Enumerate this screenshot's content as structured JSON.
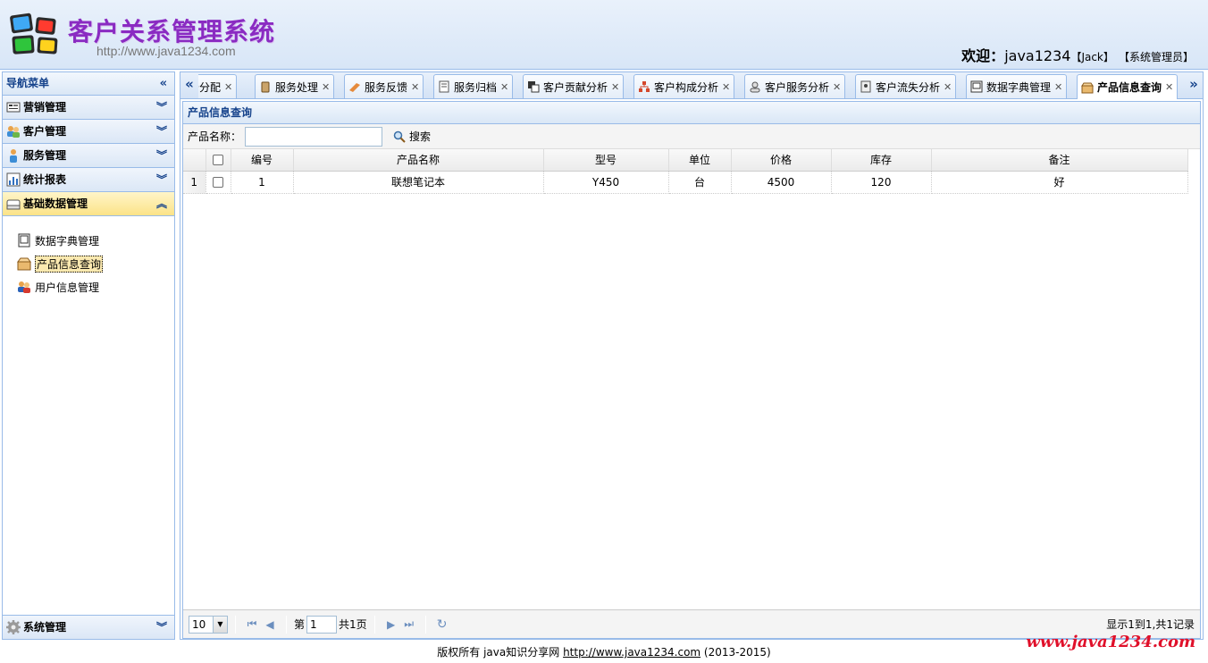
{
  "header": {
    "title": "客户关系管理系统",
    "url": "http://www.java1234.com",
    "welcome_prefix": "欢迎：",
    "username": "java1234",
    "true_name": "【Jack】",
    "role": "【系统管理员】"
  },
  "nav": {
    "title": "导航菜单",
    "sections": [
      {
        "label": "营销管理",
        "icon": "marketing-icon"
      },
      {
        "label": "客户管理",
        "icon": "customer-icon"
      },
      {
        "label": "服务管理",
        "icon": "service-icon"
      },
      {
        "label": "统计报表",
        "icon": "report-icon"
      },
      {
        "label": "基础数据管理",
        "icon": "data-icon"
      }
    ],
    "items": [
      {
        "label": "数据字典管理",
        "icon": "dictionary-icon"
      },
      {
        "label": "产品信息查询",
        "icon": "product-icon"
      },
      {
        "label": "用户信息管理",
        "icon": "users-icon"
      }
    ],
    "bottom": {
      "label": "系统管理",
      "icon": "gear-icon"
    }
  },
  "tabs": [
    {
      "label": "服务分配",
      "icon": "assign-icon"
    },
    {
      "label": "服务处理",
      "icon": "process-icon"
    },
    {
      "label": "服务反馈",
      "icon": "feedback-icon"
    },
    {
      "label": "服务归档",
      "icon": "archive-icon"
    },
    {
      "label": "客户贡献分析",
      "icon": "contribution-icon"
    },
    {
      "label": "客户构成分析",
      "icon": "structure-icon"
    },
    {
      "label": "客户服务分析",
      "icon": "service-analysis-icon"
    },
    {
      "label": "客户流失分析",
      "icon": "loss-icon"
    },
    {
      "label": "数据字典管理",
      "icon": "dictionary-icon"
    },
    {
      "label": "产品信息查询",
      "icon": "product-icon"
    }
  ],
  "panel": {
    "title": "产品信息查询",
    "search_label": "产品名称：",
    "search_value": "",
    "search_button": "搜索"
  },
  "grid": {
    "columns": [
      "编号",
      "产品名称",
      "型号",
      "单位",
      "价格",
      "库存",
      "备注"
    ],
    "rows": [
      {
        "rownum": "1",
        "cells": [
          "1",
          "联想笔记本",
          "Y450",
          "台",
          "4500",
          "120",
          "好"
        ]
      }
    ]
  },
  "pager": {
    "page_size": "10",
    "page_prefix": "第",
    "page_value": "1",
    "page_total": "共1页",
    "info": "显示1到1,共1记录"
  },
  "footer": {
    "prefix": "版权所有 java知识分享网 ",
    "link": "http://www.java1234.com",
    "suffix": " (2013-2015)",
    "watermark": "www.java1234.com"
  },
  "colors": {
    "title": "#8a2bc2",
    "border": "#99bbe8",
    "header_text": "#15428b",
    "watermark": "#e0102a"
  }
}
